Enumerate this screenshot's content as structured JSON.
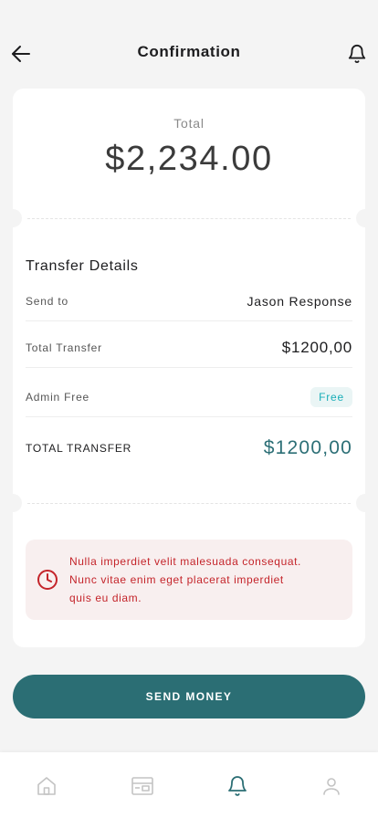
{
  "header": {
    "title": "Confirmation",
    "back_icon": "arrow-left-icon",
    "notification_icon": "bell-icon"
  },
  "summary": {
    "total_label": "Total",
    "total_amount": "$2,234.00"
  },
  "transfer_details": {
    "title": "Transfer Details",
    "rows": [
      {
        "label": "Send to",
        "value": "Jason Response"
      },
      {
        "label": "Total Transfer",
        "value": "$1200,00"
      },
      {
        "label": "Admin Free",
        "value": "Free"
      },
      {
        "label": "TOTAL TRANSFER",
        "value": "$1200,00"
      }
    ]
  },
  "alert": {
    "icon": "clock-icon",
    "lines": [
      "Nulla imperdiet velit  malesuada consequat.",
      "Nunc vitae enim eget  placerat imperdiet",
      "quis eu diam."
    ]
  },
  "actions": {
    "send_label": "SEND MONEY"
  },
  "bottom_nav": {
    "items": [
      {
        "icon": "home-icon",
        "active": false
      },
      {
        "icon": "wallet-icon",
        "active": false
      },
      {
        "icon": "bell-icon",
        "active": true
      },
      {
        "icon": "profile-icon",
        "active": false
      }
    ]
  },
  "colors": {
    "primary": "#2b6e74",
    "accent": "#19aeb8",
    "alert_text": "#c4242a",
    "alert_bg": "#f8efef",
    "background": "#f4f4f4"
  }
}
